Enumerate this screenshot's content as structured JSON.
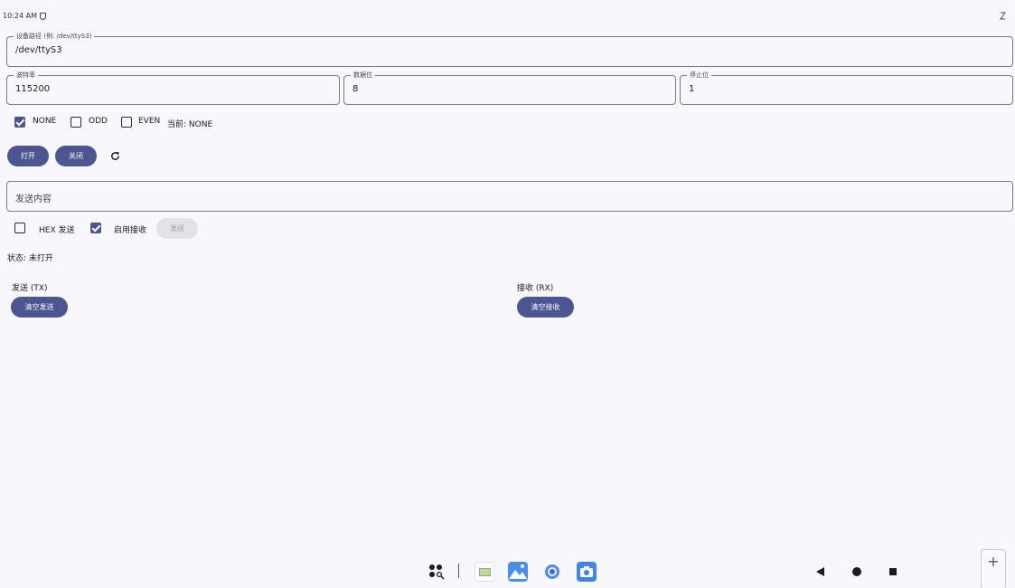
{
  "status_bar": {
    "time": "10:24 AM"
  },
  "device_path": {
    "label": "设备路径 (例: /dev/ttyS3)",
    "value": "/dev/ttyS3"
  },
  "baud_rate": {
    "label": "波特率",
    "value": "115200"
  },
  "data_bits": {
    "label": "数据位",
    "value": "8"
  },
  "stop_bits": {
    "label": "停止位",
    "value": "1"
  },
  "parity": {
    "options": [
      {
        "label": "NONE",
        "checked": true
      },
      {
        "label": "ODD",
        "checked": false
      },
      {
        "label": "EVEN",
        "checked": false
      }
    ],
    "current_text": "当前: NONE"
  },
  "actions": {
    "open_label": "打开",
    "close_label": "关闭",
    "refresh_icon": "refresh-icon"
  },
  "send_input": {
    "placeholder": "发送内容"
  },
  "send_options": {
    "hex_label": "HEX 发送",
    "hex_checked": false,
    "receive_label": "启用接收",
    "receive_checked": true,
    "send_button": "发送"
  },
  "status_text": "状态: 未打开",
  "tx_panel": {
    "title": "发送 (TX)",
    "clear_label": "清空发送"
  },
  "rx_panel": {
    "title": "接收 (RX)",
    "clear_label": "清空接收"
  },
  "colors": {
    "accent": "#4a5591",
    "background": "#f7f7fc"
  }
}
